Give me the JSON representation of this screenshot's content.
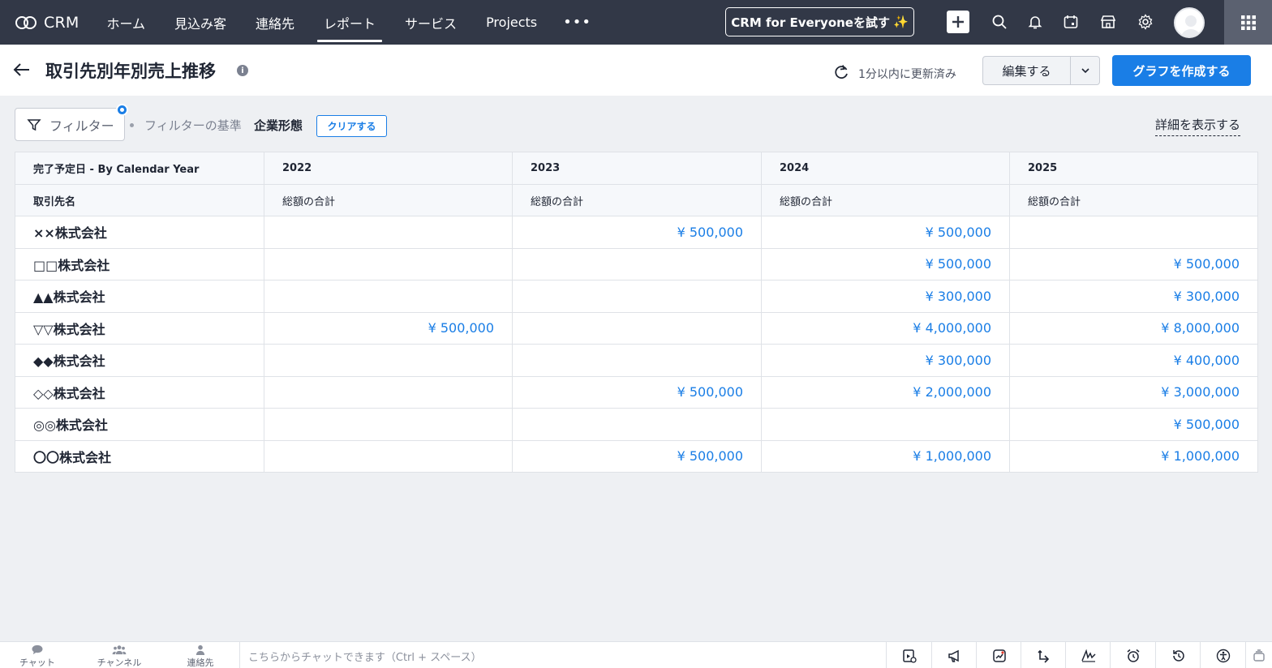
{
  "nav": {
    "brand": "CRM",
    "items": [
      "ホーム",
      "見込み客",
      "連絡先",
      "レポート",
      "サービス",
      "Projects"
    ],
    "active_index": 3,
    "more": "•••",
    "try_button": "CRM for Everyoneを試す",
    "try_sparkle": "✨"
  },
  "header": {
    "title": "取引先別年別売上推移",
    "info": "i",
    "refresh_status": "1分以内に更新済み",
    "edit_button": "編集する",
    "create_chart_button": "グラフを作成する"
  },
  "filter": {
    "button_label": "フィルター",
    "basis_label": "フィルターの基準",
    "basis_value": "企業形態",
    "clear_button": "クリアする",
    "details_link": "詳細を表示する"
  },
  "table": {
    "row_dimension_header": "完了予定日 - By Calendar Year",
    "account_header": "取引先名",
    "years": [
      "2022",
      "2023",
      "2024",
      "2025"
    ],
    "measure_label": "総額の合計",
    "rows": [
      {
        "name": "××株式会社",
        "values": [
          "",
          "¥ 500,000",
          "¥ 500,000",
          ""
        ]
      },
      {
        "name": "□□株式会社",
        "values": [
          "",
          "",
          "¥ 500,000",
          "¥ 500,000"
        ]
      },
      {
        "name": "▲▲株式会社",
        "values": [
          "",
          "",
          "¥ 300,000",
          "¥ 300,000"
        ]
      },
      {
        "name": "▽▽株式会社",
        "values": [
          "¥ 500,000",
          "",
          "¥ 4,000,000",
          "¥ 8,000,000"
        ]
      },
      {
        "name": "◆◆株式会社",
        "values": [
          "",
          "",
          "¥ 300,000",
          "¥ 400,000"
        ]
      },
      {
        "name": "◇◇株式会社",
        "values": [
          "",
          "¥ 500,000",
          "¥ 2,000,000",
          "¥ 3,000,000"
        ]
      },
      {
        "name": "◎◎株式会社",
        "values": [
          "",
          "",
          "",
          "¥ 500,000"
        ]
      },
      {
        "name": "〇〇株式会社",
        "values": [
          "",
          "¥ 500,000",
          "¥ 1,000,000",
          "¥ 1,000,000"
        ]
      }
    ]
  },
  "bottombar": {
    "tabs": [
      "チャット",
      "チャンネル",
      "連絡先"
    ],
    "chat_placeholder": "こちらからチャットできます（Ctrl + スペース）"
  },
  "icons": {
    "brand_logo": "crm-logo-icon",
    "top": [
      "plus-icon",
      "search-icon",
      "bell-icon",
      "calendar-icon",
      "store-icon",
      "gear-icon",
      "avatar",
      "apps-grid-icon"
    ],
    "bottom_tools": [
      "media-icon",
      "megaphone-icon",
      "chart-icon",
      "reply-icon",
      "signature-icon",
      "alarm-icon",
      "history-icon",
      "accessibility-icon"
    ]
  },
  "colors": {
    "topnav_bg": "#323847",
    "accent": "#1a7ee6",
    "page_bg": "#eef0f3"
  }
}
